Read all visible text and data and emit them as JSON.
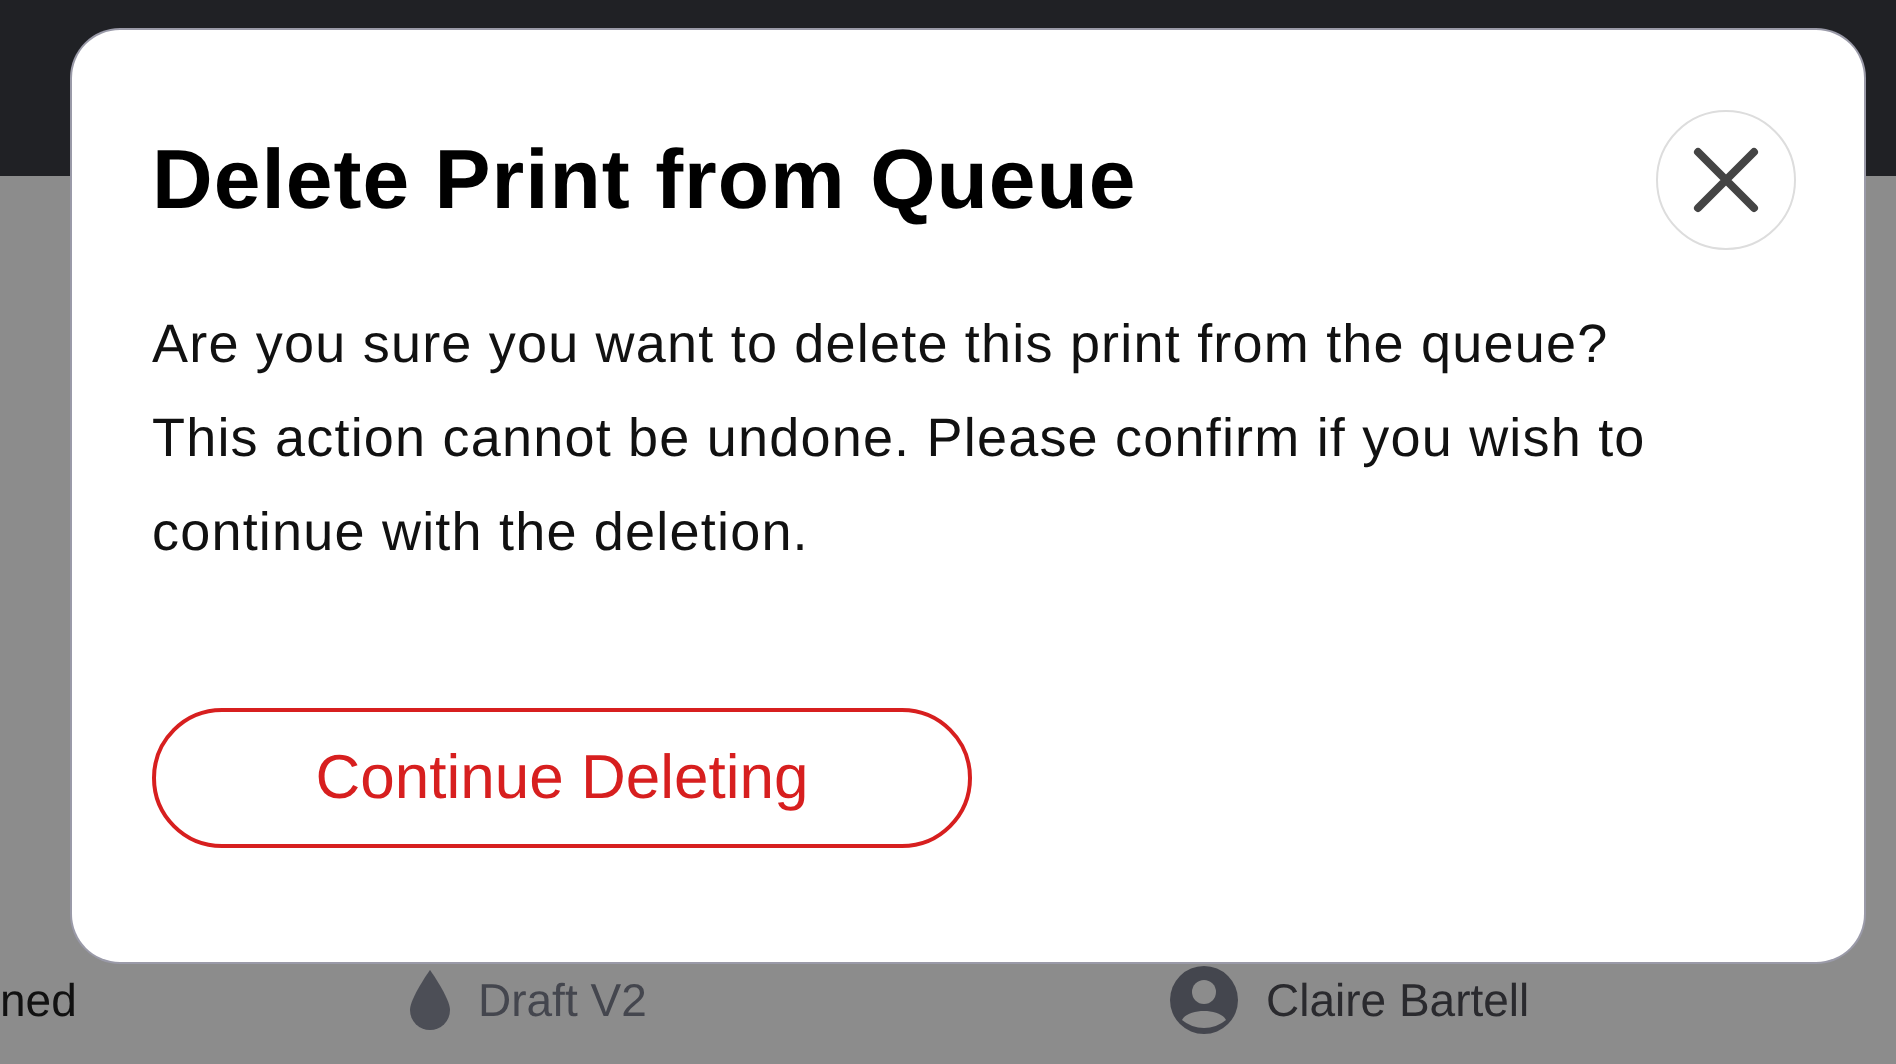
{
  "background_row": {
    "status": "ned",
    "version": "Draft V2",
    "owner": "Claire Bartell"
  },
  "dialog": {
    "title": "Delete Print from Queue",
    "message": "Are you sure you want to delete this print from the queue? This action cannot be undone. Please confirm if you wish to continue with the deletion.",
    "button": "Continue Deleting"
  }
}
